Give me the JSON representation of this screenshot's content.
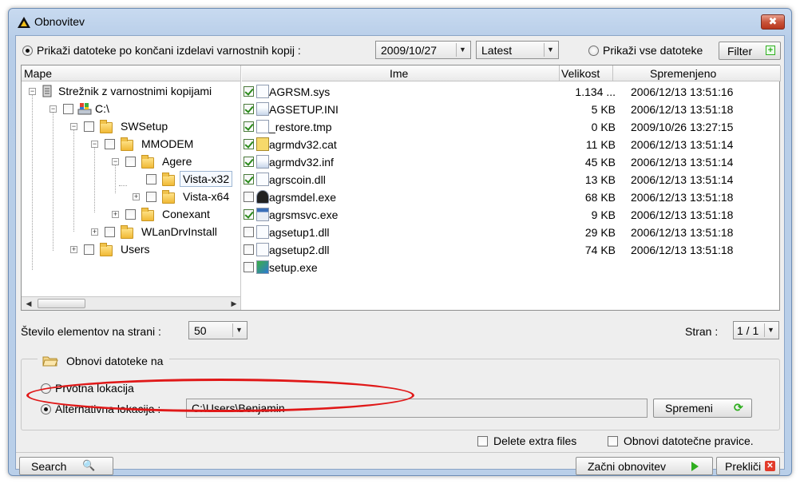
{
  "window": {
    "title": "Obnovitev",
    "close_label": "✖"
  },
  "top": {
    "radio_label": "Prikaži datoteke po končani izdelavi varnostnih kopij :",
    "date_value": "2009/10/27",
    "version_value": "Latest",
    "all_radio_label": "Prikaži vse datoteke",
    "filter_label": "Filter"
  },
  "tree": {
    "header": "Mape",
    "nodes": [
      {
        "label": "Strežnik z varnostnimi kopijami"
      },
      {
        "label": "C:\\"
      },
      {
        "label": "SWSetup"
      },
      {
        "label": "MMODEM"
      },
      {
        "label": "Agere"
      },
      {
        "label": "Vista-x32"
      },
      {
        "label": "Vista-x64"
      },
      {
        "label": "Conexant"
      },
      {
        "label": "WLanDrvInstall"
      },
      {
        "label": "Users"
      }
    ]
  },
  "files": {
    "headers": {
      "name": "Ime",
      "size": "Velikost",
      "modified": "Spremenjeno"
    },
    "rows": [
      {
        "name": "AGRSM.sys",
        "size": "1.134 ...",
        "modified": "2006/12/13 13:51:16",
        "checked": true
      },
      {
        "name": "AGSETUP.INI",
        "size": "5 KB",
        "modified": "2006/12/13 13:51:18",
        "checked": true
      },
      {
        "name": "_restore.tmp",
        "size": "0 KB",
        "modified": "2009/10/26 13:27:15",
        "checked": true
      },
      {
        "name": "agrmdv32.cat",
        "size": "11 KB",
        "modified": "2006/12/13 13:51:14",
        "checked": true
      },
      {
        "name": "agrmdv32.inf",
        "size": "45 KB",
        "modified": "2006/12/13 13:51:14",
        "checked": true
      },
      {
        "name": "agrscoin.dll",
        "size": "13 KB",
        "modified": "2006/12/13 13:51:14",
        "checked": true
      },
      {
        "name": "agrsmdel.exe",
        "size": "68 KB",
        "modified": "2006/12/13 13:51:18",
        "checked": false
      },
      {
        "name": "agrsmsvc.exe",
        "size": "9 KB",
        "modified": "2006/12/13 13:51:18",
        "checked": true
      },
      {
        "name": "agsetup1.dll",
        "size": "29 KB",
        "modified": "2006/12/13 13:51:18",
        "checked": false
      },
      {
        "name": "agsetup2.dll",
        "size": "74 KB",
        "modified": "2006/12/13 13:51:18",
        "checked": false
      },
      {
        "name": "setup.exe",
        "size": "",
        "modified": "",
        "checked": false
      }
    ]
  },
  "paging": {
    "per_page_label": "Število elementov na strani :",
    "per_page_value": "50",
    "page_label": "Stran :",
    "page_value": "1 / 1"
  },
  "restore": {
    "group_label": "Obnovi datoteke na",
    "original_label": "Prvotna lokacija",
    "alternative_label": "Alternativna lokacija :",
    "path_value": "C:\\Users\\Benjamin",
    "change_label": "Spremeni"
  },
  "options": {
    "delete_extra_label": "Delete extra files",
    "restore_perms_label": "Obnovi datotečne pravice."
  },
  "footer": {
    "search_label": "Search",
    "start_label": "Začni obnovitev",
    "cancel_label": "Prekliči"
  },
  "colors": {
    "annotation": "#e01818",
    "check": "#2a8a1a",
    "accent_green": "#2fae1f"
  }
}
